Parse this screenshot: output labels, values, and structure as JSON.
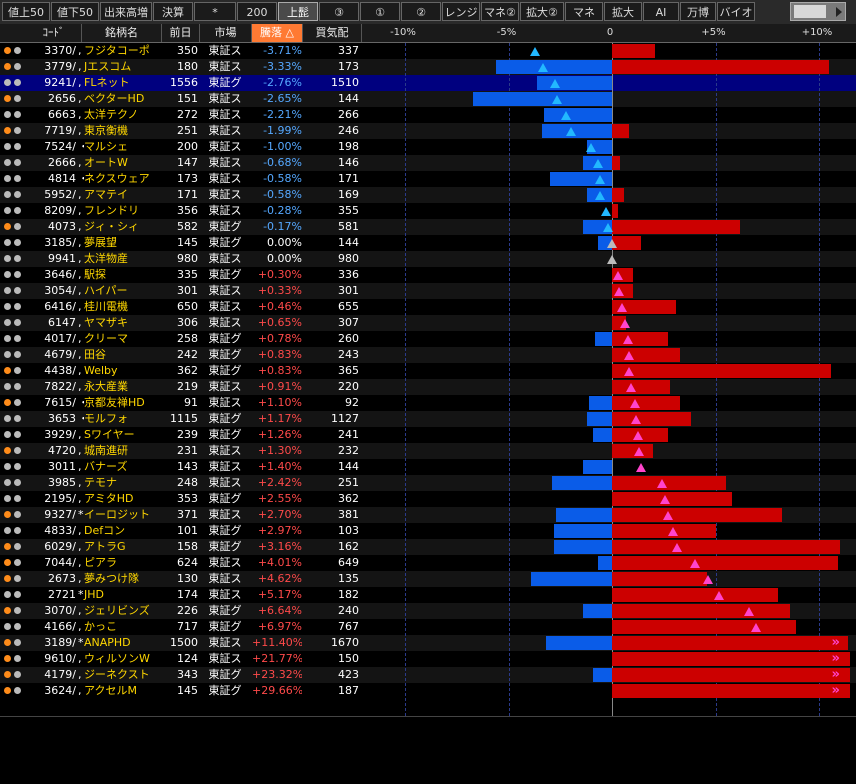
{
  "toolbar": {
    "tabs": [
      {
        "label": "値上50",
        "active": false
      },
      {
        "label": "値下50",
        "active": false
      },
      {
        "label": "出来高増",
        "active": false
      },
      {
        "label": "決算",
        "active": false
      },
      {
        "label": "*",
        "active": false
      },
      {
        "label": "200",
        "active": false
      },
      {
        "label": "上髭",
        "active": true
      },
      {
        "label": "③",
        "active": false
      },
      {
        "label": "①",
        "active": false
      },
      {
        "label": "②",
        "active": false
      },
      {
        "label": "レンジ",
        "active": false
      },
      {
        "label": "マネ②",
        "active": false
      },
      {
        "label": "拡大②",
        "active": false
      },
      {
        "label": "マネ",
        "active": false
      },
      {
        "label": "拡大",
        "active": false
      },
      {
        "label": "AI",
        "active": false
      },
      {
        "label": "万博",
        "active": false
      },
      {
        "label": "バイオ",
        "active": false
      }
    ]
  },
  "header": {
    "code": "ｺｰﾄﾞ",
    "name": "銘柄名",
    "prev": "前日",
    "market": "市場",
    "pct": "騰落 △",
    "kehai": "買気配",
    "axis": [
      "-10%",
      "-5%",
      "0",
      "+5%",
      "+10%"
    ]
  },
  "colors": {
    "up_bar": "#cc0000",
    "down_bar": "#0a5ce8",
    "up_tri": "#ff44cc",
    "down_tri": "#22b8ff",
    "zero_tri": "#bbbbbb",
    "name": "#ffd700"
  },
  "rows": [
    {
      "code": "3370/",
      "mark": ",",
      "name": "フジタコーポ",
      "prev": "350",
      "market": "東証ス",
      "pct": "-3.71%",
      "kehai": "337",
      "pv": -3.71,
      "bar": 2.1,
      "dot1": "#ff8c1a",
      "dot2": "#bbbbbb"
    },
    {
      "code": "3779/",
      "mark": ",",
      "name": "Jエスコム",
      "prev": "180",
      "market": "東証ス",
      "pct": "-3.33%",
      "kehai": "173",
      "pv": -3.33,
      "bar": -5.6,
      "bar2": 10.5,
      "dot1": "#ff8c1a",
      "dot2": "#bbbbbb"
    },
    {
      "code": "9241/",
      "mark": ",",
      "name": "FLネット",
      "prev": "1556",
      "market": "東証グ",
      "pct": "-2.76%",
      "kehai": "1510",
      "pv": -2.76,
      "bar": -3.6,
      "selected": true,
      "dot1": "#bbbbbb",
      "dot2": "#bbbbbb"
    },
    {
      "code": "2656",
      "mark": ",",
      "name": "ベクターHD",
      "prev": "151",
      "market": "東証ス",
      "pct": "-2.65%",
      "kehai": "144",
      "pv": -2.65,
      "bar": -6.7,
      "dot1": "#ff8c1a",
      "dot2": "#bbbbbb"
    },
    {
      "code": "6663",
      "mark": ",",
      "name": "太洋テクノ",
      "prev": "272",
      "market": "東証ス",
      "pct": "-2.21%",
      "kehai": "266",
      "pv": -2.21,
      "bar": -3.3,
      "dot1": "#bbbbbb",
      "dot2": "#bbbbbb"
    },
    {
      "code": "7719/",
      "mark": ",",
      "name": "東京衡機",
      "prev": "251",
      "market": "東証ス",
      "pct": "-1.99%",
      "kehai": "246",
      "pv": -1.99,
      "bar": -3.4,
      "bar2": 0.8,
      "dot1": "#ff8c1a",
      "dot2": "#bbbbbb"
    },
    {
      "code": "7524/",
      "mark": "・",
      "name": "マルシェ",
      "prev": "200",
      "market": "東証ス",
      "pct": "-1.00%",
      "kehai": "198",
      "pv": -1.0,
      "bar": -1.2,
      "dot1": "#bbbbbb",
      "dot2": "#bbbbbb"
    },
    {
      "code": "2666",
      "mark": ",",
      "name": "オートW",
      "prev": "147",
      "market": "東証ス",
      "pct": "-0.68%",
      "kehai": "146",
      "pv": -0.68,
      "bar": -1.4,
      "bar2": 0.4,
      "dot1": "#bbbbbb",
      "dot2": "#bbbbbb"
    },
    {
      "code": "4814",
      "mark": "・",
      "name": "ネクスウェア",
      "prev": "173",
      "market": "東証ス",
      "pct": "-0.58%",
      "kehai": "171",
      "pv": -0.58,
      "bar": -3.0,
      "dot1": "#bbbbbb",
      "dot2": "#bbbbbb"
    },
    {
      "code": "5952/",
      "mark": ",",
      "name": "アマテイ",
      "prev": "171",
      "market": "東証ス",
      "pct": "-0.58%",
      "kehai": "169",
      "pv": -0.58,
      "bar": -1.2,
      "bar2": 0.6,
      "dot1": "#bbbbbb",
      "dot2": "#bbbbbb"
    },
    {
      "code": "8209/",
      "mark": ",",
      "name": "フレンドリ",
      "prev": "356",
      "market": "東証ス",
      "pct": "-0.28%",
      "kehai": "355",
      "pv": -0.28,
      "bar": 0.3,
      "dot1": "#bbbbbb",
      "dot2": "#bbbbbb"
    },
    {
      "code": "4073",
      "mark": ",",
      "name": "ジィ・シィ",
      "prev": "582",
      "market": "東証グ",
      "pct": "-0.17%",
      "kehai": "581",
      "pv": -0.17,
      "bar": -1.4,
      "bar2": 6.2,
      "dot1": "#ff8c1a",
      "dot2": "#bbbbbb"
    },
    {
      "code": "3185/",
      "mark": ",",
      "name": "夢展望",
      "prev": "145",
      "market": "東証グ",
      "pct": "0.00%",
      "kehai": "144",
      "pv": 0.0,
      "bar": -0.7,
      "bar2": 1.4,
      "dot1": "#bbbbbb",
      "dot2": "#bbbbbb"
    },
    {
      "code": "9941",
      "mark": ",",
      "name": "太洋物産",
      "prev": "980",
      "market": "東証ス",
      "pct": "0.00%",
      "kehai": "980",
      "pv": 0.0,
      "bar": 0.0,
      "dot1": "#bbbbbb",
      "dot2": "#bbbbbb"
    },
    {
      "code": "3646/",
      "mark": ",",
      "name": "駅探",
      "prev": "335",
      "market": "東証グ",
      "pct": "+0.30%",
      "kehai": "336",
      "pv": 0.3,
      "bar": 1.0,
      "dot1": "#bbbbbb",
      "dot2": "#bbbbbb"
    },
    {
      "code": "3054/",
      "mark": ",",
      "name": "ハイパー",
      "prev": "301",
      "market": "東証ス",
      "pct": "+0.33%",
      "kehai": "301",
      "pv": 0.33,
      "bar": 1.0,
      "dot1": "#bbbbbb",
      "dot2": "#bbbbbb"
    },
    {
      "code": "6416/",
      "mark": ",",
      "name": "桂川電機",
      "prev": "650",
      "market": "東証ス",
      "pct": "+0.46%",
      "kehai": "655",
      "pv": 0.46,
      "bar": 3.1,
      "dot1": "#bbbbbb",
      "dot2": "#bbbbbb"
    },
    {
      "code": "6147",
      "mark": ",",
      "name": "ヤマザキ",
      "prev": "306",
      "market": "東証ス",
      "pct": "+0.65%",
      "kehai": "307",
      "pv": 0.65,
      "bar": 0.7,
      "dot1": "#bbbbbb",
      "dot2": "#bbbbbb"
    },
    {
      "code": "4017/",
      "mark": ",",
      "name": "クリーマ",
      "prev": "258",
      "market": "東証グ",
      "pct": "+0.78%",
      "kehai": "260",
      "pv": 0.78,
      "bar": -0.8,
      "bar2": 2.7,
      "dot1": "#bbbbbb",
      "dot2": "#bbbbbb"
    },
    {
      "code": "4679/",
      "mark": ",",
      "name": "田谷",
      "prev": "242",
      "market": "東証グ",
      "pct": "+0.83%",
      "kehai": "243",
      "pv": 0.83,
      "bar": 3.3,
      "dot1": "#bbbbbb",
      "dot2": "#bbbbbb"
    },
    {
      "code": "4438/",
      "mark": ",",
      "name": "Welby",
      "prev": "362",
      "market": "東証グ",
      "pct": "+0.83%",
      "kehai": "365",
      "pv": 0.83,
      "bar": 10.6,
      "dot1": "#ff8c1a",
      "dot2": "#bbbbbb"
    },
    {
      "code": "7822/",
      "mark": ",",
      "name": "永大産業",
      "prev": "219",
      "market": "東証ス",
      "pct": "+0.91%",
      "kehai": "220",
      "pv": 0.91,
      "bar": 2.8,
      "dot1": "#bbbbbb",
      "dot2": "#bbbbbb"
    },
    {
      "code": "7615/",
      "mark": "・",
      "name": "京都友禅HD",
      "prev": "91",
      "market": "東証ス",
      "pct": "+1.10%",
      "kehai": "92",
      "pv": 1.1,
      "bar": -1.1,
      "bar2": 3.3,
      "dot1": "#ff8c1a",
      "dot2": "#bbbbbb"
    },
    {
      "code": "3653",
      "mark": "・",
      "name": "モルフォ",
      "prev": "1115",
      "market": "東証グ",
      "pct": "+1.17%",
      "kehai": "1127",
      "pv": 1.17,
      "bar": -1.2,
      "bar2": 3.8,
      "dot1": "#bbbbbb",
      "dot2": "#bbbbbb"
    },
    {
      "code": "3929/",
      "mark": ",",
      "name": "Sワイヤー",
      "prev": "239",
      "market": "東証グ",
      "pct": "+1.26%",
      "kehai": "241",
      "pv": 1.26,
      "bar": -0.9,
      "bar2": 2.7,
      "dot1": "#bbbbbb",
      "dot2": "#bbbbbb"
    },
    {
      "code": "4720",
      "mark": ",",
      "name": "城南進研",
      "prev": "231",
      "market": "東証ス",
      "pct": "+1.30%",
      "kehai": "232",
      "pv": 1.3,
      "bar": 1.0,
      "bar2": 2.0,
      "dot1": "#ff8c1a",
      "dot2": "#bbbbbb"
    },
    {
      "code": "3011",
      "mark": ",",
      "name": "バナーズ",
      "prev": "143",
      "market": "東証ス",
      "pct": "+1.40%",
      "kehai": "144",
      "pv": 1.4,
      "bar": -1.4,
      "dot1": "#bbbbbb",
      "dot2": "#bbbbbb"
    },
    {
      "code": "3985",
      "mark": ",",
      "name": "テモナ",
      "prev": "248",
      "market": "東証ス",
      "pct": "+2.42%",
      "kehai": "251",
      "pv": 2.42,
      "bar": -2.9,
      "bar2": 5.5,
      "dot1": "#bbbbbb",
      "dot2": "#bbbbbb"
    },
    {
      "code": "2195/",
      "mark": ",",
      "name": "アミタHD",
      "prev": "353",
      "market": "東証グ",
      "pct": "+2.55%",
      "kehai": "362",
      "pv": 2.55,
      "bar": 5.8,
      "dot1": "#bbbbbb",
      "dot2": "#bbbbbb"
    },
    {
      "code": "9327/",
      "mark": "*",
      "name": "イーロジット",
      "prev": "371",
      "market": "東証ス",
      "pct": "+2.70%",
      "kehai": "381",
      "pv": 2.7,
      "bar": -2.7,
      "bar2": 8.2,
      "dot1": "#ff8c1a",
      "dot2": "#bbbbbb"
    },
    {
      "code": "4833/",
      "mark": ",",
      "name": "Defコン",
      "prev": "101",
      "market": "東証グ",
      "pct": "+2.97%",
      "kehai": "103",
      "pv": 2.97,
      "bar": -2.8,
      "bar2": 5.0,
      "dot1": "#bbbbbb",
      "dot2": "#bbbbbb"
    },
    {
      "code": "6029/",
      "mark": ",",
      "name": "アトラG",
      "prev": "158",
      "market": "東証グ",
      "pct": "+3.16%",
      "kehai": "162",
      "pv": 3.16,
      "bar": -2.8,
      "bar2": 11.0,
      "dot1": "#ff8c1a",
      "dot2": "#bbbbbb"
    },
    {
      "code": "7044/",
      "mark": ",",
      "name": "ピアラ",
      "prev": "624",
      "market": "東証ス",
      "pct": "+4.01%",
      "kehai": "649",
      "pv": 4.01,
      "bar": -0.7,
      "bar2": 10.9,
      "dot1": "#ff8c1a",
      "dot2": "#bbbbbb"
    },
    {
      "code": "2673",
      "mark": ",",
      "name": "夢みつけ隊",
      "prev": "130",
      "market": "東証ス",
      "pct": "+4.62%",
      "kehai": "135",
      "pv": 4.62,
      "bar": -3.9,
      "bar2": 4.6,
      "dot1": "#ff8c1a",
      "dot2": "#bbbbbb"
    },
    {
      "code": "2721",
      "mark": "*",
      "name": "JHD",
      "prev": "174",
      "market": "東証ス",
      "pct": "+5.17%",
      "kehai": "182",
      "pv": 5.17,
      "bar": 2.3,
      "bar2": 8.0,
      "dot1": "#bbbbbb",
      "dot2": "#bbbbbb"
    },
    {
      "code": "3070/",
      "mark": ",",
      "name": "ジェリビンズ",
      "prev": "226",
      "market": "東証グ",
      "pct": "+6.64%",
      "kehai": "240",
      "pv": 6.64,
      "bar": -1.4,
      "bar2": 8.6,
      "dot1": "#ff8c1a",
      "dot2": "#bbbbbb"
    },
    {
      "code": "4166/",
      "mark": ",",
      "name": "かっこ",
      "prev": "717",
      "market": "東証グ",
      "pct": "+6.97%",
      "kehai": "767",
      "pv": 6.97,
      "bar": 8.9,
      "dot1": "#bbbbbb",
      "dot2": "#bbbbbb"
    },
    {
      "code": "3189/",
      "mark": "*",
      "name": "ANAPHD",
      "prev": "1500",
      "market": "東証ス",
      "pct": "+11.40%",
      "kehai": "1670",
      "pv": 11.4,
      "bar": -3.2,
      "bar2": 11.4,
      "dot1": "#ff8c1a",
      "dot2": "#bbbbbb"
    },
    {
      "code": "9610/",
      "mark": ",",
      "name": "ウィルソンW",
      "prev": "124",
      "market": "東証ス",
      "pct": "+21.77%",
      "kehai": "150",
      "pv": 21.77,
      "bar": 11.5,
      "dot1": "#ff8c1a",
      "dot2": "#bbbbbb"
    },
    {
      "code": "4179/",
      "mark": ",",
      "name": "ジーネクスト",
      "prev": "343",
      "market": "東証グ",
      "pct": "+23.32%",
      "kehai": "423",
      "pv": 23.32,
      "bar": -0.9,
      "bar2": 11.5,
      "dot1": "#ff8c1a",
      "dot2": "#bbbbbb"
    },
    {
      "code": "3624/",
      "mark": ",",
      "name": "アクセルM",
      "prev": "145",
      "market": "東証グ",
      "pct": "+29.66%",
      "kehai": "187",
      "pv": 29.66,
      "bar": 2.0,
      "bar2": 11.5,
      "dot1": "#ff8c1a",
      "dot2": "#bbbbbb"
    }
  ]
}
